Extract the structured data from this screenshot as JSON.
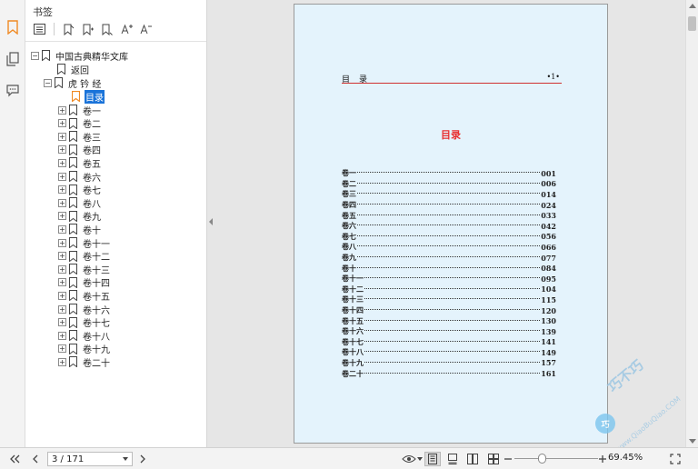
{
  "panel": {
    "title": "书签",
    "tree": {
      "root": "中国古典精华文库",
      "back": "返回",
      "book": "虎 钤 经",
      "selected": "目录",
      "chapters": [
        "卷一",
        "卷二",
        "卷三",
        "卷四",
        "卷五",
        "卷六",
        "卷七",
        "卷八",
        "卷九",
        "卷十",
        "卷十一",
        "卷十二",
        "卷十三",
        "卷十四",
        "卷十五",
        "卷十六",
        "卷十七",
        "卷十八",
        "卷十九",
        "卷二十"
      ]
    }
  },
  "page": {
    "header_left": "目录",
    "header_right": "•1•",
    "title": "目录",
    "toc": [
      {
        "name": "卷一",
        "num": "001"
      },
      {
        "name": "卷二",
        "num": "006"
      },
      {
        "name": "卷三",
        "num": "014"
      },
      {
        "name": "卷四",
        "num": "024"
      },
      {
        "name": "卷五",
        "num": "033"
      },
      {
        "name": "卷六",
        "num": "042"
      },
      {
        "name": "卷七",
        "num": "056"
      },
      {
        "name": "卷八",
        "num": "066"
      },
      {
        "name": "卷九",
        "num": "077"
      },
      {
        "name": "卷十",
        "num": "084"
      },
      {
        "name": "卷十一",
        "num": "095"
      },
      {
        "name": "卷十二",
        "num": "104"
      },
      {
        "name": "卷十三",
        "num": "115"
      },
      {
        "name": "卷十四",
        "num": "120"
      },
      {
        "name": "卷十五",
        "num": "130"
      },
      {
        "name": "卷十六",
        "num": "139"
      },
      {
        "name": "卷十七",
        "num": "141"
      },
      {
        "name": "卷十八",
        "num": "149"
      },
      {
        "name": "卷十九",
        "num": "157"
      },
      {
        "name": "卷二十",
        "num": "161"
      }
    ]
  },
  "watermark": {
    "text": "巧不巧",
    "sub": "www.QiaoBuQiao.COM",
    "badge": "巧"
  },
  "statusbar": {
    "page_input": "3 / 171",
    "zoom": "69.45%"
  },
  "colors": {
    "selection": "#1a73d9",
    "page_background": "#e4f3fc",
    "title_red": "#e83030",
    "bookmark_orange": "#f08a24"
  }
}
